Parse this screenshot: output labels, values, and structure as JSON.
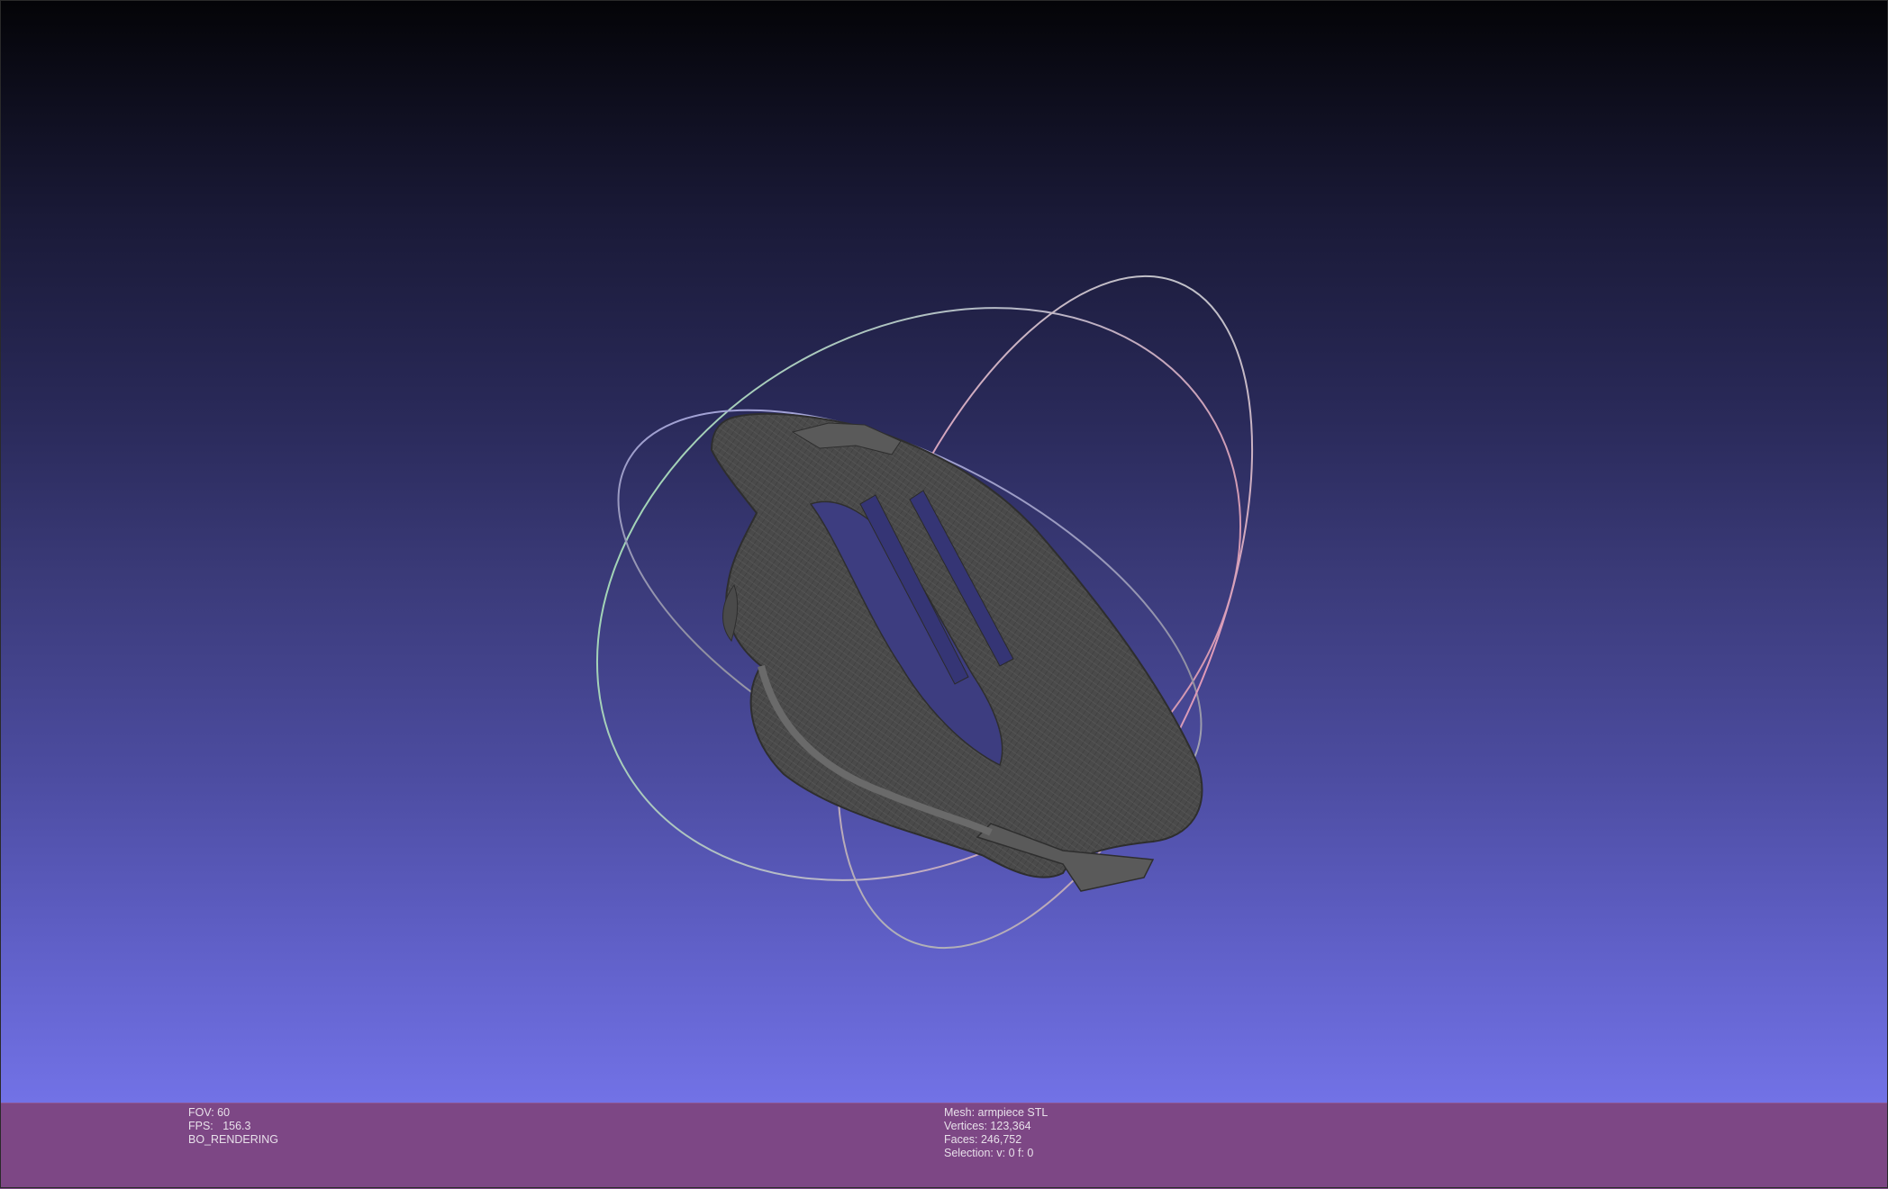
{
  "viewer": {
    "mode": "BO_RENDERING"
  },
  "status_left": {
    "fov": "FOV: 60",
    "fps": "FPS:   156.3",
    "mode": "BO_RENDERING"
  },
  "status_right": {
    "mesh": "Mesh: armpiece STL",
    "vertices": "Vertices: 123,364",
    "faces": "Faces: 246,752",
    "selection": "Selection: v: 0 f: 0"
  },
  "colors": {
    "infobar_bg": "#7d4785",
    "trackball_x": "#e08aa8",
    "trackball_y": "#8fd6a8",
    "trackball_z": "#9a9ae8",
    "mesh_fill": "#4a4a4a"
  }
}
